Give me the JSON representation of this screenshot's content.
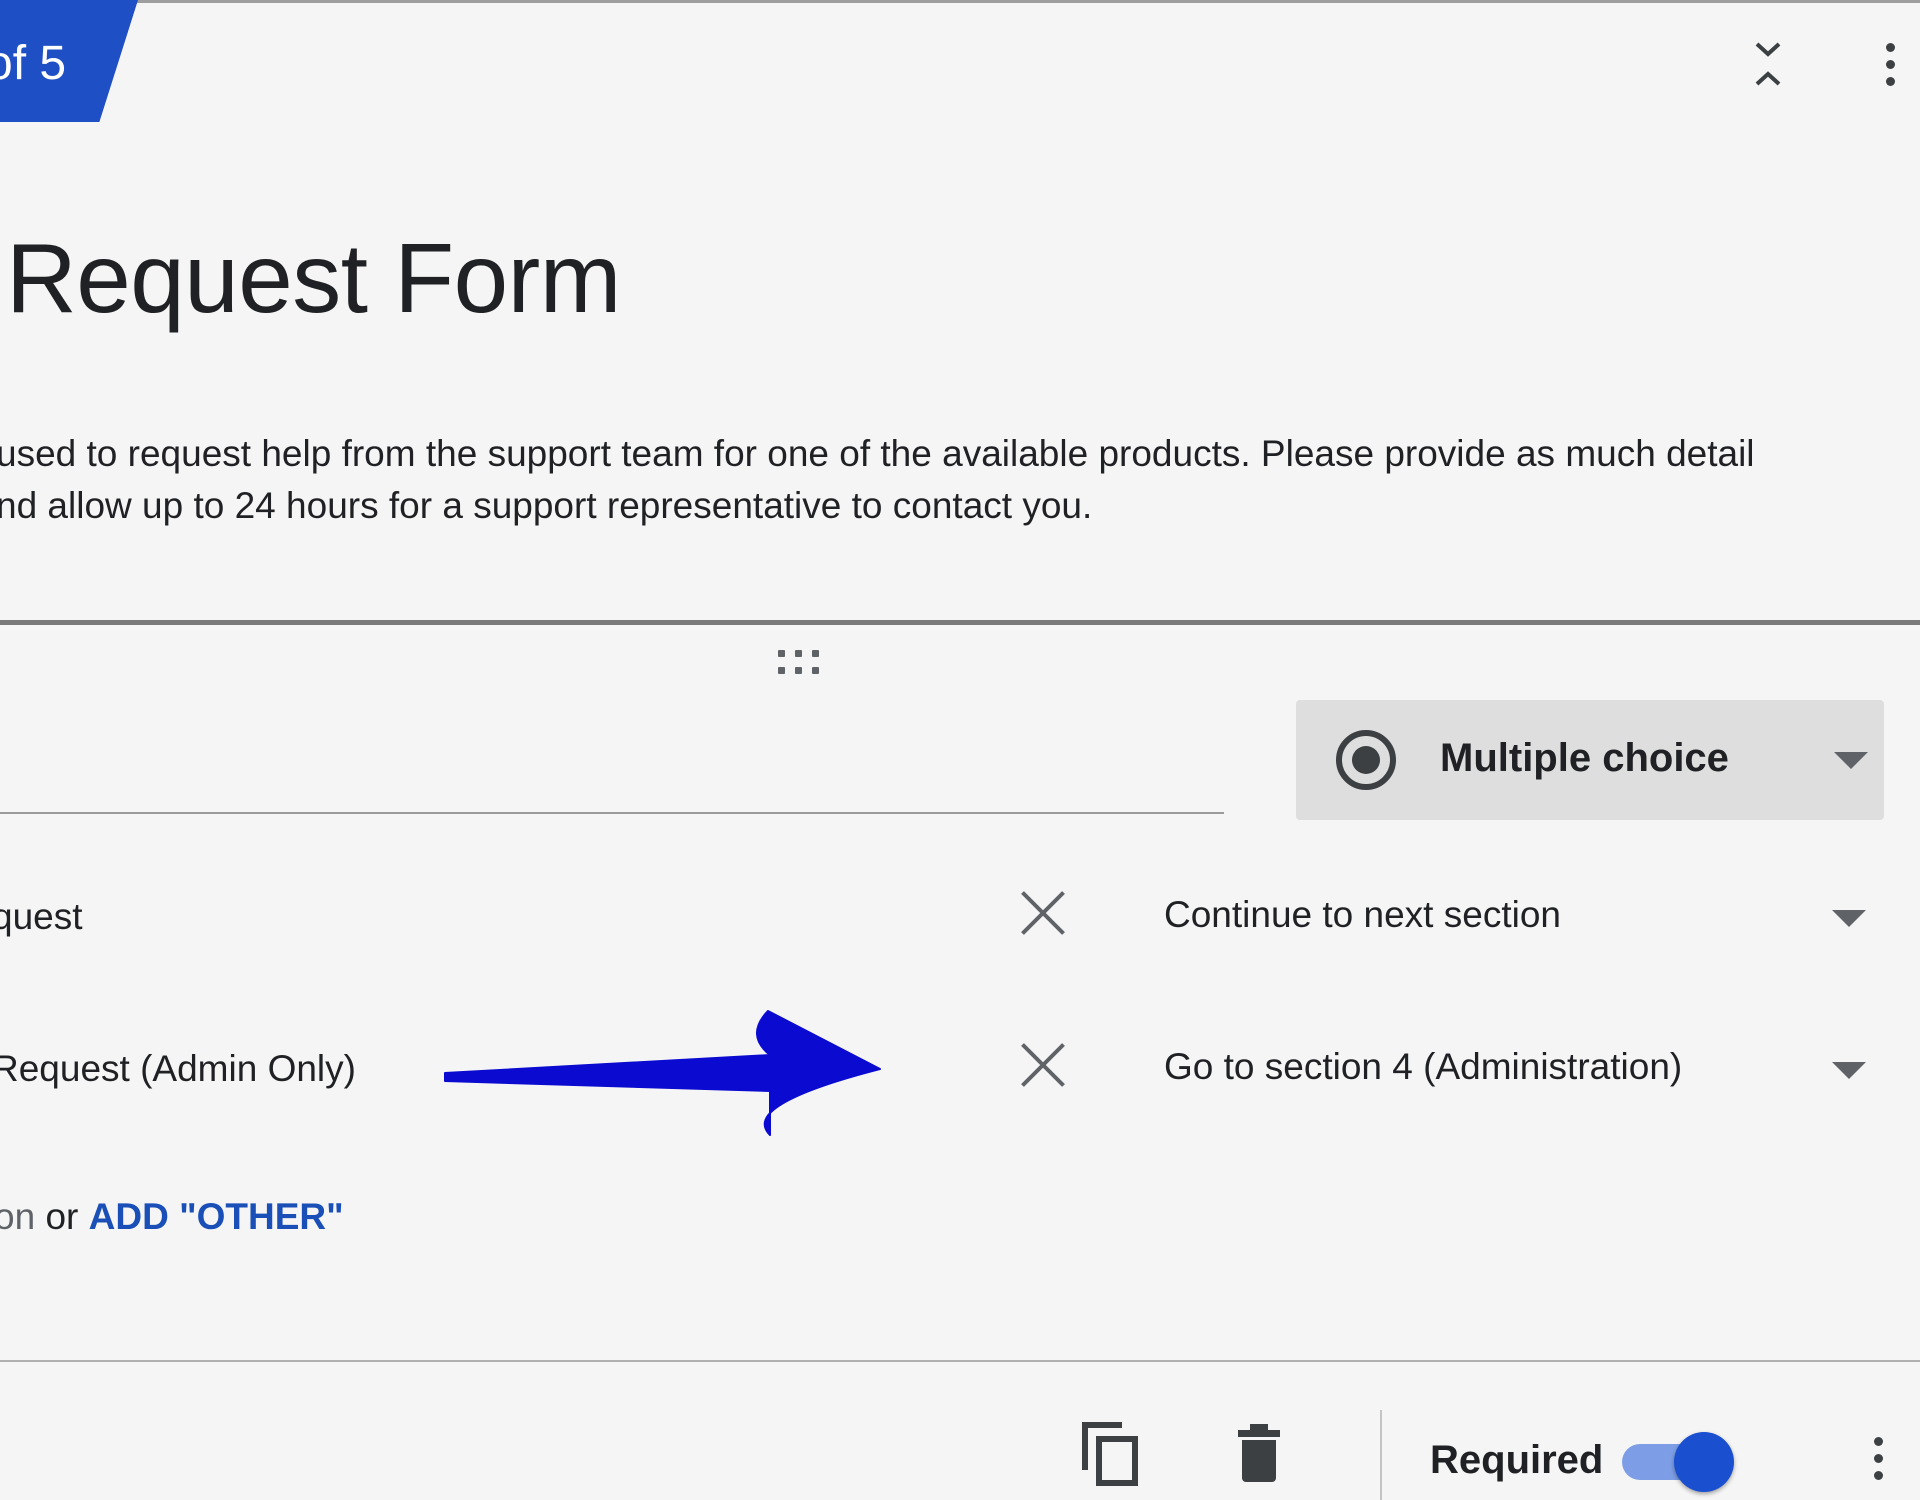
{
  "section_header": {
    "tab_label": "of 5",
    "title": "Request Form",
    "description_lines": [
      "used to request help from the support team for one of the available products.  Please provide as much detail",
      "nd allow up to 24 hours for a support representative to contact you."
    ],
    "collapse_icon": "collapse-expand-icon",
    "menu_icon": "more-vert-icon"
  },
  "question": {
    "drag_icon": "drag-handle-icon",
    "type_selector": {
      "icon": "radio-button-icon",
      "label": "Multiple choice"
    },
    "options": [
      {
        "label": "quest",
        "remove_icon": "close-icon",
        "go_to": "Continue to next section"
      },
      {
        "label": "Request (Admin Only)",
        "remove_icon": "close-icon",
        "go_to": "Go to section 4 (Administration)"
      }
    ],
    "add_option_text": "on",
    "or_text": "or",
    "add_other_text": "ADD \"OTHER\"",
    "annotation": {
      "arrow_icon": "annotation-arrow",
      "color": "#0a0ad0"
    }
  },
  "footer": {
    "duplicate_icon": "duplicate-icon",
    "delete_icon": "delete-icon",
    "required_label": "Required",
    "required_on": true,
    "menu_icon": "more-vert-icon"
  },
  "colors": {
    "accent": "#1f4fc4",
    "link": "#1a4fb8",
    "toggle_on": "#1a4fd0",
    "background": "#f5f5f5"
  }
}
